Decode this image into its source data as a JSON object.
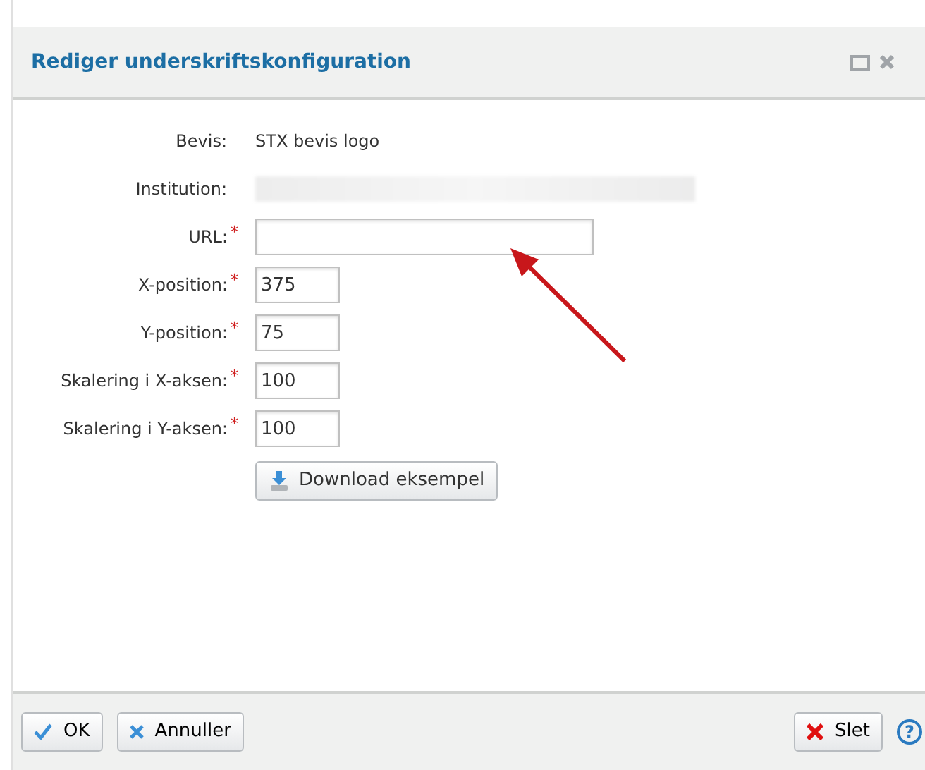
{
  "dialog": {
    "title": "Rediger underskriftskonfiguration"
  },
  "fields": [
    {
      "label": "Bevis:",
      "kind": "text",
      "required": false,
      "value": "STX bevis logo"
    },
    {
      "label": "Institution:",
      "kind": "redacted",
      "required": false
    },
    {
      "label": "URL:",
      "kind": "long_input",
      "required": true
    },
    {
      "label": "X-position:",
      "kind": "short_input",
      "required": true,
      "value": "375"
    },
    {
      "label": "Y-position:",
      "kind": "short_input",
      "required": true,
      "value": "75"
    },
    {
      "label": "Skalering i X-aksen:",
      "kind": "short_input",
      "required": true,
      "value": "100"
    },
    {
      "label": "Skalering i Y-aksen:",
      "kind": "short_input",
      "required": true,
      "value": "100"
    }
  ],
  "download_button": "Download eksempel",
  "required_mark": "*",
  "footer": {
    "ok": "OK",
    "cancel": "Annuller",
    "delete": "Slet",
    "help": "?"
  }
}
